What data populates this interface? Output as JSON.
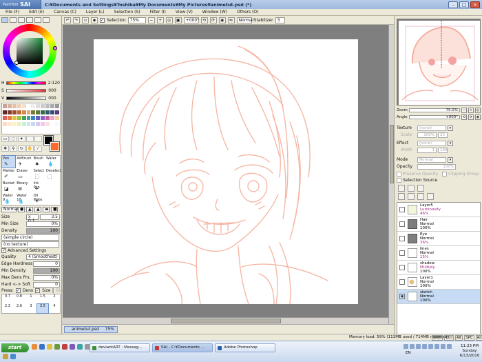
{
  "title_bar": {
    "app_logo": "SAI",
    "app_logo_prefix": "PaintTool",
    "title": "C:¥Documents and Settings¥Toshiba¥My Documents¥My Pictures¥animetut.psd (*)"
  },
  "menu": [
    "File (F)",
    "Edit (E)",
    "Canvas (C)",
    "Layer (L)",
    "Selection (S)",
    "Filter (I)",
    "View (V)",
    "Window (W)",
    "Others (O)"
  ],
  "toolbar": {
    "selection_label": "Selection",
    "zoom": "75%",
    "rotation": "+000°",
    "mode": "Normal",
    "stabilizer_label": "Stabilizer",
    "stabilizer_value": "3"
  },
  "color": {
    "h_label": "H",
    "h_value": "2:120",
    "s_label": "S",
    "s_value": "000",
    "v_label": "V",
    "v_value": "000",
    "foreground": "#000000",
    "background": "#ff6a2a"
  },
  "brushes": [
    {
      "label": "Pen",
      "icon": "pen-icon"
    },
    {
      "label": "AirBrush",
      "icon": "airbrush-icon"
    },
    {
      "label": "Brush",
      "icon": "brush-icon"
    },
    {
      "label": "Water",
      "icon": "water-icon"
    },
    {
      "label": "Marker",
      "icon": "marker-icon"
    },
    {
      "label": "Eraser",
      "icon": "eraser-icon"
    },
    {
      "label": "Select",
      "icon": "select-icon"
    },
    {
      "label": "Deselect",
      "icon": "deselect-icon"
    },
    {
      "label": "Bucket",
      "icon": "bucket-icon"
    },
    {
      "label": "Binary",
      "icon": "binary-icon"
    },
    {
      "label": "Ink Pen",
      "icon": "ink-pen-icon"
    },
    {
      "label": "",
      "icon": ""
    },
    {
      "label": "Water 9",
      "icon": "water-icon"
    },
    {
      "label": "Water 10",
      "icon": "water-icon"
    },
    {
      "label": "Oil Wate",
      "icon": "oil-water-icon"
    },
    {
      "label": "",
      "icon": ""
    }
  ],
  "tool_options": {
    "mode": "Normal",
    "size_label": "Size",
    "size_mult": "x 0.1",
    "size_value": "3.5",
    "min_size_label": "Min Size",
    "min_size_value": "0%",
    "density_label": "Density",
    "density_value": "100",
    "shape": "(simple circle)",
    "texture": "(no texture)",
    "advanced_label": "Advanced Settings",
    "quality_label": "Quality",
    "quality_value": "4 (Smoothest)",
    "edge_label": "Edge Hardness",
    "edge_value": "0",
    "min_density_label": "Min Density",
    "min_density_value": "100",
    "max_dens_label": "Max Dens Prs.",
    "max_dens_value": "0%",
    "hard_soft_label": "Hard <-> Soft",
    "hard_soft_value": "0",
    "press_label": "Press:",
    "press_dens": "Dens",
    "press_size": "Size",
    "press_blend": "Blend"
  },
  "size_presets": [
    "0.7",
    "0.8",
    "1",
    "1.5",
    "2",
    "2.3",
    "2.6",
    "3",
    "3.5",
    "4"
  ],
  "file_tab": {
    "name": "animetut.psd",
    "zoom": "75%"
  },
  "navigator": {
    "zoom_label": "Zoom",
    "zoom_value": "75.0%",
    "angle_label": "Angle",
    "angle_value": "+000°"
  },
  "layer_props": {
    "texture_label": "Texture",
    "texture_value": "(none)",
    "texture_sub1": "Scale",
    "texture_sub1_value": "100%",
    "texture_sub1_extra": "20",
    "effect_label": "Effect",
    "effect_value": "(none)",
    "effect_sub": "Width",
    "effect_sub_value": "1",
    "effect_sub_extra": "100",
    "mode_label": "Mode",
    "mode_value": "Normal",
    "opacity_label": "Opacity",
    "opacity_value": "100%",
    "preserve_opacity": "Preserve Opacity",
    "clipping_group": "Clipping Group",
    "selection_source": "Selection Source"
  },
  "layers": [
    {
      "name": "Layer5",
      "mode": "Luminosity",
      "opacity": "46%",
      "thumb": "yellowish",
      "mode_colored": true,
      "opacity_colored": true
    },
    {
      "name": "Hair",
      "mode": "Normal",
      "opacity": "100%",
      "thumb": "folder"
    },
    {
      "name": "Eye",
      "mode": "Normal",
      "opacity": "36%",
      "thumb": "folder",
      "opacity_colored": true
    },
    {
      "name": "lines",
      "mode": "Normal",
      "opacity": "15%",
      "thumb": "plain",
      "opacity_colored": true
    },
    {
      "name": "shadow",
      "mode": "Multiply",
      "opacity": "100%",
      "thumb": "plain",
      "mode_colored": true
    },
    {
      "name": "Layer1",
      "mode": "Normal",
      "opacity": "100%",
      "thumb": "face"
    },
    {
      "name": "sketch",
      "mode": "Normal",
      "opacity": "100%",
      "thumb": "plain",
      "selected": true
    }
  ],
  "status": {
    "memory": "Memory load: 59% (113MB used / 714MB reserved)",
    "keys": [
      "Shift",
      "Ctrl",
      "Alt",
      "SPC",
      "Any"
    ]
  },
  "taskbar": {
    "start": "start",
    "tasks": [
      {
        "label": "deviantART : Messag...",
        "color": "#3f8f3f"
      },
      {
        "label": "SAI - C:¥Documents ...",
        "color": "#c43a3a",
        "active": true
      },
      {
        "label": "Adobe Photoshop",
        "color": "#2a5fa8"
      }
    ],
    "lang": "EN",
    "time": "11:23 PM",
    "day": "Sunday",
    "date": "6/13/2010"
  },
  "colors": {
    "sketch_stroke": "#f6b8a6",
    "accent": "#a6288a"
  }
}
